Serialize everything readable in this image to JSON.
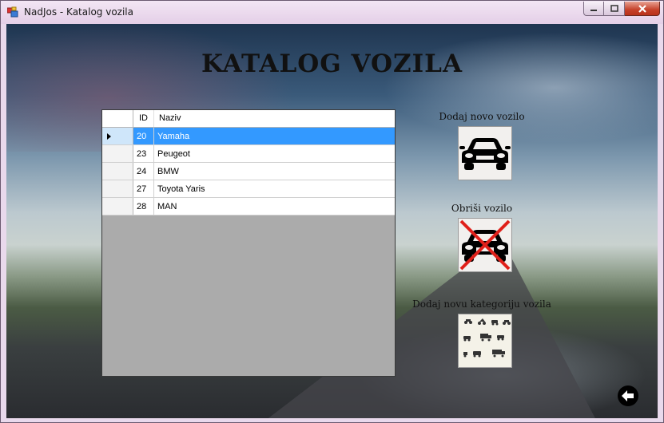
{
  "window": {
    "title": "NadJos - Katalog vozila"
  },
  "page": {
    "heading": "KATALOG VOZILA"
  },
  "grid": {
    "columns": {
      "id": "ID",
      "naziv": "Naziv"
    },
    "rows": [
      {
        "id": "20",
        "naziv": "Yamaha",
        "selected": true
      },
      {
        "id": "23",
        "naziv": "Peugeot",
        "selected": false
      },
      {
        "id": "24",
        "naziv": "BMW",
        "selected": false
      },
      {
        "id": "27",
        "naziv": "Toyota Yaris",
        "selected": false
      },
      {
        "id": "28",
        "naziv": "MAN",
        "selected": false
      }
    ]
  },
  "actions": {
    "add_vehicle_label": "Dodaj novo vozilo",
    "add_vehicle_icon": "car-icon",
    "delete_vehicle_label": "Obriši vozilo",
    "delete_vehicle_icon": "car-crossed-icon",
    "add_category_label": "Dodaj novu kategoriju vozila",
    "add_category_icon": "vehicle-categories-icon",
    "back_icon": "back-arrow-icon"
  },
  "colors": {
    "selection": "#3399ff",
    "grid_background": "#ababab",
    "delete_cross": "#e0201a"
  }
}
